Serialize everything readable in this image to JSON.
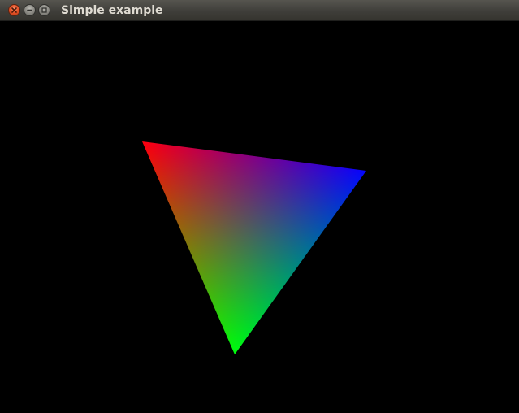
{
  "window": {
    "title": "Simple example",
    "controls": {
      "close_icon": "close-icon",
      "minimize_icon": "minimize-icon",
      "maximize_icon": "maximize-icon"
    }
  },
  "scene": {
    "background_color": "#000000",
    "triangle": {
      "vertex_colors": [
        "#ff0000",
        "#0000ff",
        "#00ff00"
      ]
    }
  }
}
